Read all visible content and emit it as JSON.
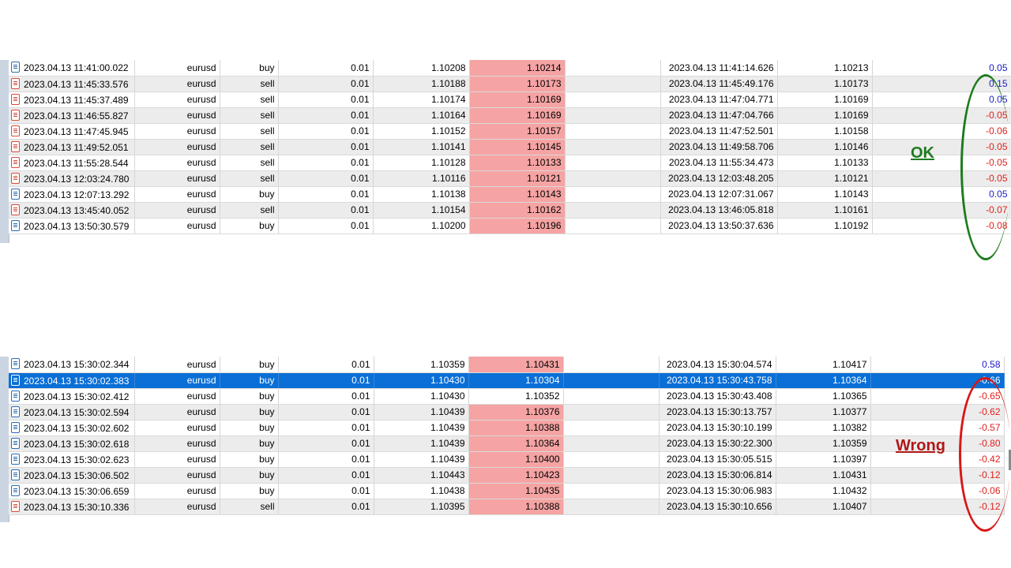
{
  "annotations": {
    "ok_label": "OK",
    "wrong_label": "Wrong",
    "ok_color": "#1f7a1f",
    "wrong_color": "#b01818"
  },
  "colors": {
    "highlight_cell": "#f5a3a3",
    "selected_row": "#0a6fd6",
    "positive_profit": "#1c1cc8",
    "negative_profit": "#e0201c"
  },
  "top_table": {
    "rows": [
      {
        "open_time": "2023.04.13 11:41:00.022",
        "symbol": "eurusd",
        "type": "buy",
        "volume": "0.01",
        "open_price": "1.10208",
        "sl": "1.10214",
        "tp": "",
        "close_time": "2023.04.13 11:41:14.626",
        "close_price": "1.10213",
        "profit": "0.05",
        "profit_sign": "pos",
        "highlight": true
      },
      {
        "open_time": "2023.04.13 11:45:33.576",
        "symbol": "eurusd",
        "type": "sell",
        "volume": "0.01",
        "open_price": "1.10188",
        "sl": "1.10173",
        "tp": "",
        "close_time": "2023.04.13 11:45:49.176",
        "close_price": "1.10173",
        "profit": "0.15",
        "profit_sign": "pos",
        "highlight": true
      },
      {
        "open_time": "2023.04.13 11:45:37.489",
        "symbol": "eurusd",
        "type": "sell",
        "volume": "0.01",
        "open_price": "1.10174",
        "sl": "1.10169",
        "tp": "",
        "close_time": "2023.04.13 11:47:04.771",
        "close_price": "1.10169",
        "profit": "0.05",
        "profit_sign": "pos",
        "highlight": true
      },
      {
        "open_time": "2023.04.13 11:46:55.827",
        "symbol": "eurusd",
        "type": "sell",
        "volume": "0.01",
        "open_price": "1.10164",
        "sl": "1.10169",
        "tp": "",
        "close_time": "2023.04.13 11:47:04.766",
        "close_price": "1.10169",
        "profit": "-0.05",
        "profit_sign": "neg",
        "highlight": true
      },
      {
        "open_time": "2023.04.13 11:47:45.945",
        "symbol": "eurusd",
        "type": "sell",
        "volume": "0.01",
        "open_price": "1.10152",
        "sl": "1.10157",
        "tp": "",
        "close_time": "2023.04.13 11:47:52.501",
        "close_price": "1.10158",
        "profit": "-0.06",
        "profit_sign": "neg",
        "highlight": true
      },
      {
        "open_time": "2023.04.13 11:49:52.051",
        "symbol": "eurusd",
        "type": "sell",
        "volume": "0.01",
        "open_price": "1.10141",
        "sl": "1.10145",
        "tp": "",
        "close_time": "2023.04.13 11:49:58.706",
        "close_price": "1.10146",
        "profit": "-0.05",
        "profit_sign": "neg",
        "highlight": true
      },
      {
        "open_time": "2023.04.13 11:55:28.544",
        "symbol": "eurusd",
        "type": "sell",
        "volume": "0.01",
        "open_price": "1.10128",
        "sl": "1.10133",
        "tp": "",
        "close_time": "2023.04.13 11:55:34.473",
        "close_price": "1.10133",
        "profit": "-0.05",
        "profit_sign": "neg",
        "highlight": true
      },
      {
        "open_time": "2023.04.13 12:03:24.780",
        "symbol": "eurusd",
        "type": "sell",
        "volume": "0.01",
        "open_price": "1.10116",
        "sl": "1.10121",
        "tp": "",
        "close_time": "2023.04.13 12:03:48.205",
        "close_price": "1.10121",
        "profit": "-0.05",
        "profit_sign": "neg",
        "highlight": true
      },
      {
        "open_time": "2023.04.13 12:07:13.292",
        "symbol": "eurusd",
        "type": "buy",
        "volume": "0.01",
        "open_price": "1.10138",
        "sl": "1.10143",
        "tp": "",
        "close_time": "2023.04.13 12:07:31.067",
        "close_price": "1.10143",
        "profit": "0.05",
        "profit_sign": "pos",
        "highlight": true
      },
      {
        "open_time": "2023.04.13 13:45:40.052",
        "symbol": "eurusd",
        "type": "sell",
        "volume": "0.01",
        "open_price": "1.10154",
        "sl": "1.10162",
        "tp": "",
        "close_time": "2023.04.13 13:46:05.818",
        "close_price": "1.10161",
        "profit": "-0.07",
        "profit_sign": "neg",
        "highlight": true
      },
      {
        "open_time": "2023.04.13 13:50:30.579",
        "symbol": "eurusd",
        "type": "buy",
        "volume": "0.01",
        "open_price": "1.10200",
        "sl": "1.10196",
        "tp": "",
        "close_time": "2023.04.13 13:50:37.636",
        "close_price": "1.10192",
        "profit": "-0.08",
        "profit_sign": "neg",
        "highlight": true
      }
    ]
  },
  "bottom_table": {
    "rows": [
      {
        "open_time": "2023.04.13 15:30:02.344",
        "symbol": "eurusd",
        "type": "buy",
        "volume": "0.01",
        "open_price": "1.10359",
        "sl": "1.10431",
        "tp": "",
        "close_time": "2023.04.13 15:30:04.574",
        "close_price": "1.10417",
        "profit": "0.58",
        "profit_sign": "pos",
        "highlight": true
      },
      {
        "open_time": "2023.04.13 15:30:02.383",
        "symbol": "eurusd",
        "type": "buy",
        "volume": "0.01",
        "open_price": "1.10430",
        "sl": "1.10304",
        "tp": "",
        "close_time": "2023.04.13 15:30:43.758",
        "close_price": "1.10364",
        "profit": "-0.66",
        "profit_sign": "neg",
        "highlight": true,
        "selected": true
      },
      {
        "open_time": "2023.04.13 15:30:02.412",
        "symbol": "eurusd",
        "type": "buy",
        "volume": "0.01",
        "open_price": "1.10430",
        "sl": "1.10352",
        "tp": "",
        "close_time": "2023.04.13 15:30:43.408",
        "close_price": "1.10365",
        "profit": "-0.65",
        "profit_sign": "neg",
        "highlight": false
      },
      {
        "open_time": "2023.04.13 15:30:02.594",
        "symbol": "eurusd",
        "type": "buy",
        "volume": "0.01",
        "open_price": "1.10439",
        "sl": "1.10376",
        "tp": "",
        "close_time": "2023.04.13 15:30:13.757",
        "close_price": "1.10377",
        "profit": "-0.62",
        "profit_sign": "neg",
        "highlight": true
      },
      {
        "open_time": "2023.04.13 15:30:02.602",
        "symbol": "eurusd",
        "type": "buy",
        "volume": "0.01",
        "open_price": "1.10439",
        "sl": "1.10388",
        "tp": "",
        "close_time": "2023.04.13 15:30:10.199",
        "close_price": "1.10382",
        "profit": "-0.57",
        "profit_sign": "neg",
        "highlight": true
      },
      {
        "open_time": "2023.04.13 15:30:02.618",
        "symbol": "eurusd",
        "type": "buy",
        "volume": "0.01",
        "open_price": "1.10439",
        "sl": "1.10364",
        "tp": "",
        "close_time": "2023.04.13 15:30:22.300",
        "close_price": "1.10359",
        "profit": "-0.80",
        "profit_sign": "neg",
        "highlight": true
      },
      {
        "open_time": "2023.04.13 15:30:02.623",
        "symbol": "eurusd",
        "type": "buy",
        "volume": "0.01",
        "open_price": "1.10439",
        "sl": "1.10400",
        "tp": "",
        "close_time": "2023.04.13 15:30:05.515",
        "close_price": "1.10397",
        "profit": "-0.42",
        "profit_sign": "neg",
        "highlight": true
      },
      {
        "open_time": "2023.04.13 15:30:06.502",
        "symbol": "eurusd",
        "type": "buy",
        "volume": "0.01",
        "open_price": "1.10443",
        "sl": "1.10423",
        "tp": "",
        "close_time": "2023.04.13 15:30:06.814",
        "close_price": "1.10431",
        "profit": "-0.12",
        "profit_sign": "neg",
        "highlight": true
      },
      {
        "open_time": "2023.04.13 15:30:06.659",
        "symbol": "eurusd",
        "type": "buy",
        "volume": "0.01",
        "open_price": "1.10438",
        "sl": "1.10435",
        "tp": "",
        "close_time": "2023.04.13 15:30:06.983",
        "close_price": "1.10432",
        "profit": "-0.06",
        "profit_sign": "neg",
        "highlight": true
      },
      {
        "open_time": "2023.04.13 15:30:10.336",
        "symbol": "eurusd",
        "type": "sell",
        "volume": "0.01",
        "open_price": "1.10395",
        "sl": "1.10388",
        "tp": "",
        "close_time": "2023.04.13 15:30:10.656",
        "close_price": "1.10407",
        "profit": "-0.12",
        "profit_sign": "neg",
        "highlight": true
      }
    ]
  }
}
